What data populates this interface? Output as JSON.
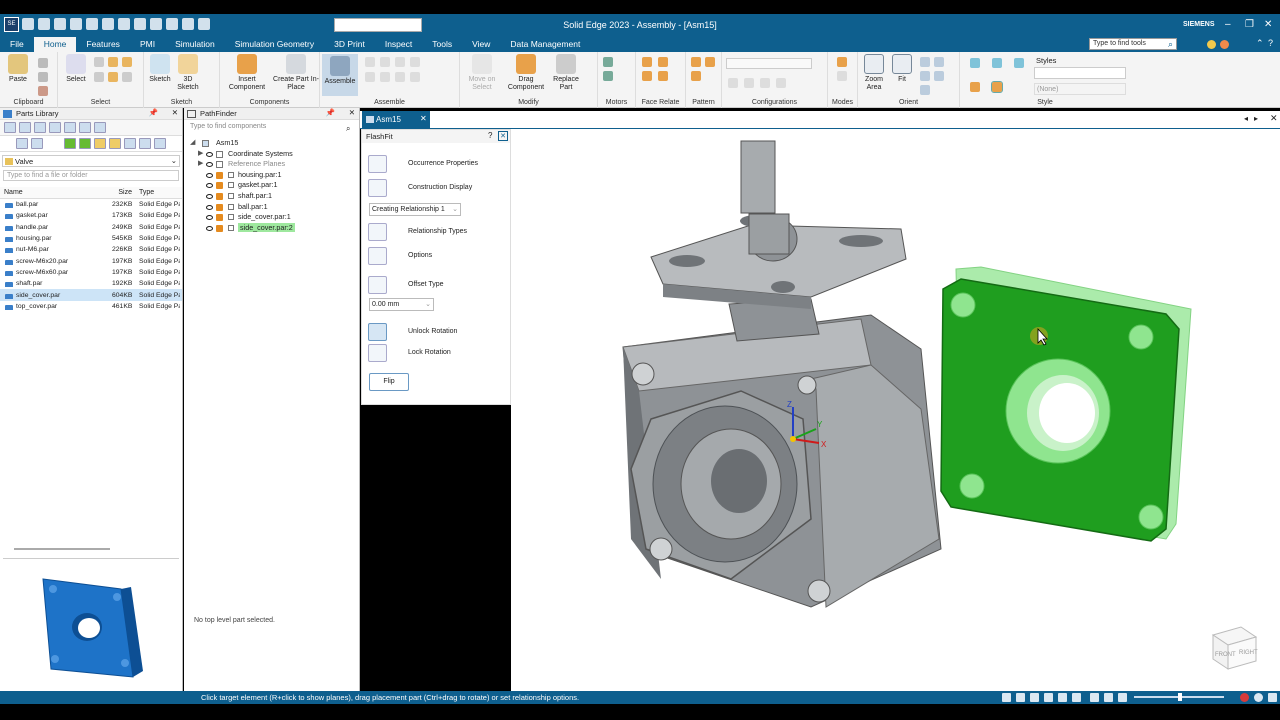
{
  "window": {
    "title": "Solid Edge 2023 - Assembly - [Asm15]",
    "brand": "SIEMENS",
    "app_icon": "SE"
  },
  "menu": {
    "items": [
      "File",
      "Home",
      "Features",
      "PMI",
      "Simulation",
      "Simulation Geometry",
      "3D Print",
      "Inspect",
      "Tools",
      "View",
      "Data Management"
    ],
    "active": "Home",
    "search_placeholder": "Type to find tools"
  },
  "ribbon": {
    "groups": [
      {
        "label": "Clipboard",
        "buttons": [
          "Paste"
        ]
      },
      {
        "label": "Select",
        "buttons": [
          "Select"
        ]
      },
      {
        "label": "Sketch",
        "buttons": [
          "Sketch",
          "3D Sketch"
        ]
      },
      {
        "label": "Components",
        "buttons": [
          "Insert Component",
          "Create Part In-Place"
        ]
      },
      {
        "label": "Assemble",
        "buttons": [
          "Assemble"
        ]
      },
      {
        "label": "Modify",
        "buttons": [
          "Move on Select",
          "Drag Component",
          "Replace Part"
        ]
      },
      {
        "label": "Motors",
        "buttons": []
      },
      {
        "label": "Face Relate",
        "buttons": []
      },
      {
        "label": "Pattern",
        "buttons": []
      },
      {
        "label": "Configurations",
        "buttons": []
      },
      {
        "label": "Modes",
        "buttons": []
      },
      {
        "label": "Orient",
        "buttons": [
          "Zoom Area",
          "Fit"
        ]
      },
      {
        "label": "Style",
        "buttons": []
      }
    ],
    "styles_label": "Styles",
    "style_value": "(None)"
  },
  "parts_library": {
    "title": "Parts Library",
    "search_placeholder": "Type to find a file or folder",
    "folder": "Valve",
    "columns": [
      "Name",
      "Size",
      "Type"
    ],
    "files": [
      {
        "name": "ball.par",
        "size": "232KB",
        "type": "Solid Edge Pa"
      },
      {
        "name": "gasket.par",
        "size": "173KB",
        "type": "Solid Edge Pa"
      },
      {
        "name": "handle.par",
        "size": "249KB",
        "type": "Solid Edge Pa"
      },
      {
        "name": "housing.par",
        "size": "545KB",
        "type": "Solid Edge Pa"
      },
      {
        "name": "nut-M6.par",
        "size": "226KB",
        "type": "Solid Edge Pa"
      },
      {
        "name": "screw-M6x20.par",
        "size": "197KB",
        "type": "Solid Edge Pa"
      },
      {
        "name": "screw-M6x60.par",
        "size": "197KB",
        "type": "Solid Edge Pa"
      },
      {
        "name": "shaft.par",
        "size": "192KB",
        "type": "Solid Edge Pa"
      },
      {
        "name": "side_cover.par",
        "size": "604KB",
        "type": "Solid Edge Pa"
      },
      {
        "name": "top_cover.par",
        "size": "461KB",
        "type": "Solid Edge Pa"
      }
    ],
    "selected_file": "side_cover.par"
  },
  "pathfinder": {
    "title": "PathFinder",
    "search_placeholder": "Type to find components",
    "root": "Asm15",
    "nodes": [
      "Coordinate Systems",
      "Reference Planes",
      "housing.par:1",
      "gasket.par:1",
      "shaft.par:1",
      "ball.par:1",
      "side_cover.par:1",
      "side_cover.par:2"
    ],
    "status": "No top level part selected."
  },
  "doc_tab": "Asm15",
  "flashfit": {
    "title": "FlashFit",
    "occurrence_properties": "Occurrence Properties",
    "construction_display": "Construction Display",
    "relationship": "Creating Relationship 1",
    "relationship_types": "Relationship Types",
    "options": "Options",
    "offset_type": "Offset Type",
    "offset_value": "0.00 mm",
    "unlock_rotation": "Unlock Rotation",
    "lock_rotation": "Lock Rotation",
    "flip": "Flip"
  },
  "viewcube": {
    "front": "FRONT",
    "right": "RIGHT"
  },
  "axis": {
    "x": "X",
    "y": "Y",
    "z": "Z"
  },
  "status_bar": "Click target element (R+click to show planes), drag placement part (Ctrl+drag to rotate) or set relationship options.",
  "colors": {
    "titlebar": "#0e5f8e",
    "selected_part": "#1f9e1f",
    "housing": "#9fa3a6",
    "preview_part": "#1e73c8"
  }
}
